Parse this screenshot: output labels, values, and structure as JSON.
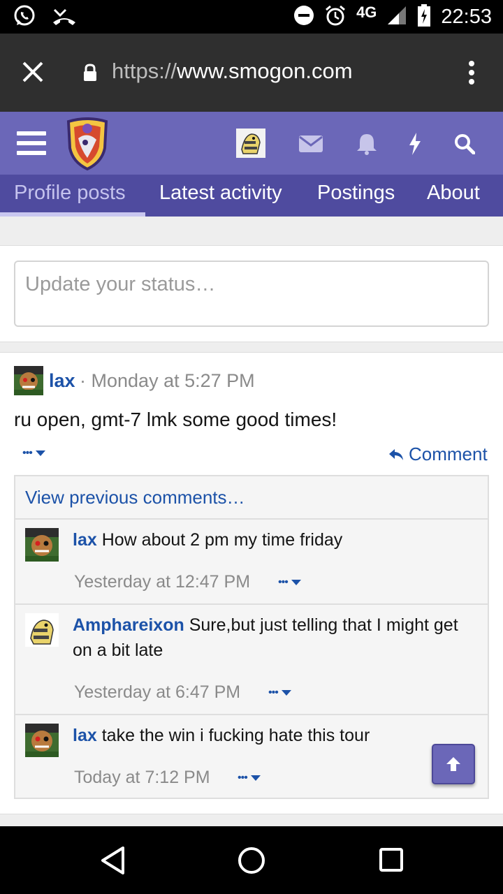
{
  "status_bar": {
    "network": "4G",
    "time": "22:53",
    "icons": [
      "whatsapp-icon",
      "missed-call-icon",
      "dnd-icon",
      "alarm-icon",
      "signal-icon",
      "battery-charging-icon"
    ]
  },
  "browser": {
    "url_scheme": "https://",
    "url_host": "www.smogon.com",
    "icons": [
      "close-icon",
      "lock-icon",
      "more-vert-icon"
    ]
  },
  "site_header": {
    "icons": [
      "hamburger-icon",
      "smogon-logo",
      "avatar",
      "envelope-icon",
      "bell-icon",
      "lightning-icon",
      "search-icon"
    ],
    "colors": {
      "header": "#6b67b8",
      "tabs": "#4f4b9f"
    }
  },
  "tabs": [
    {
      "label": "Profile posts",
      "active": true
    },
    {
      "label": "Latest activity",
      "active": false
    },
    {
      "label": "Postings",
      "active": false
    },
    {
      "label": "About",
      "active": false
    }
  ],
  "status_input": {
    "placeholder": "Update your status…"
  },
  "post": {
    "author": "lax",
    "separator": "·",
    "time": "Monday at 5:27 PM",
    "body": "ru open, gmt-7 lmk some good times!",
    "more_label": "•••",
    "comment_label": "Comment"
  },
  "comments": {
    "view_previous": "View previous comments…",
    "items": [
      {
        "author": "lax",
        "text": "How about 2 pm my time friday",
        "time": "Yesterday at 12:47 PM",
        "more_label": "•••"
      },
      {
        "author": "Amphareixon",
        "text": "Sure,but just telling that I might get on a bit late",
        "time": "Yesterday at 6:47 PM",
        "more_label": "•••"
      },
      {
        "author": "lax",
        "text": "take the win i fucking hate this tour",
        "time": "Today at 7:12 PM",
        "more_label": "•••"
      }
    ]
  },
  "colors": {
    "link": "#1c52a8",
    "muted": "#8a8a8a"
  }
}
